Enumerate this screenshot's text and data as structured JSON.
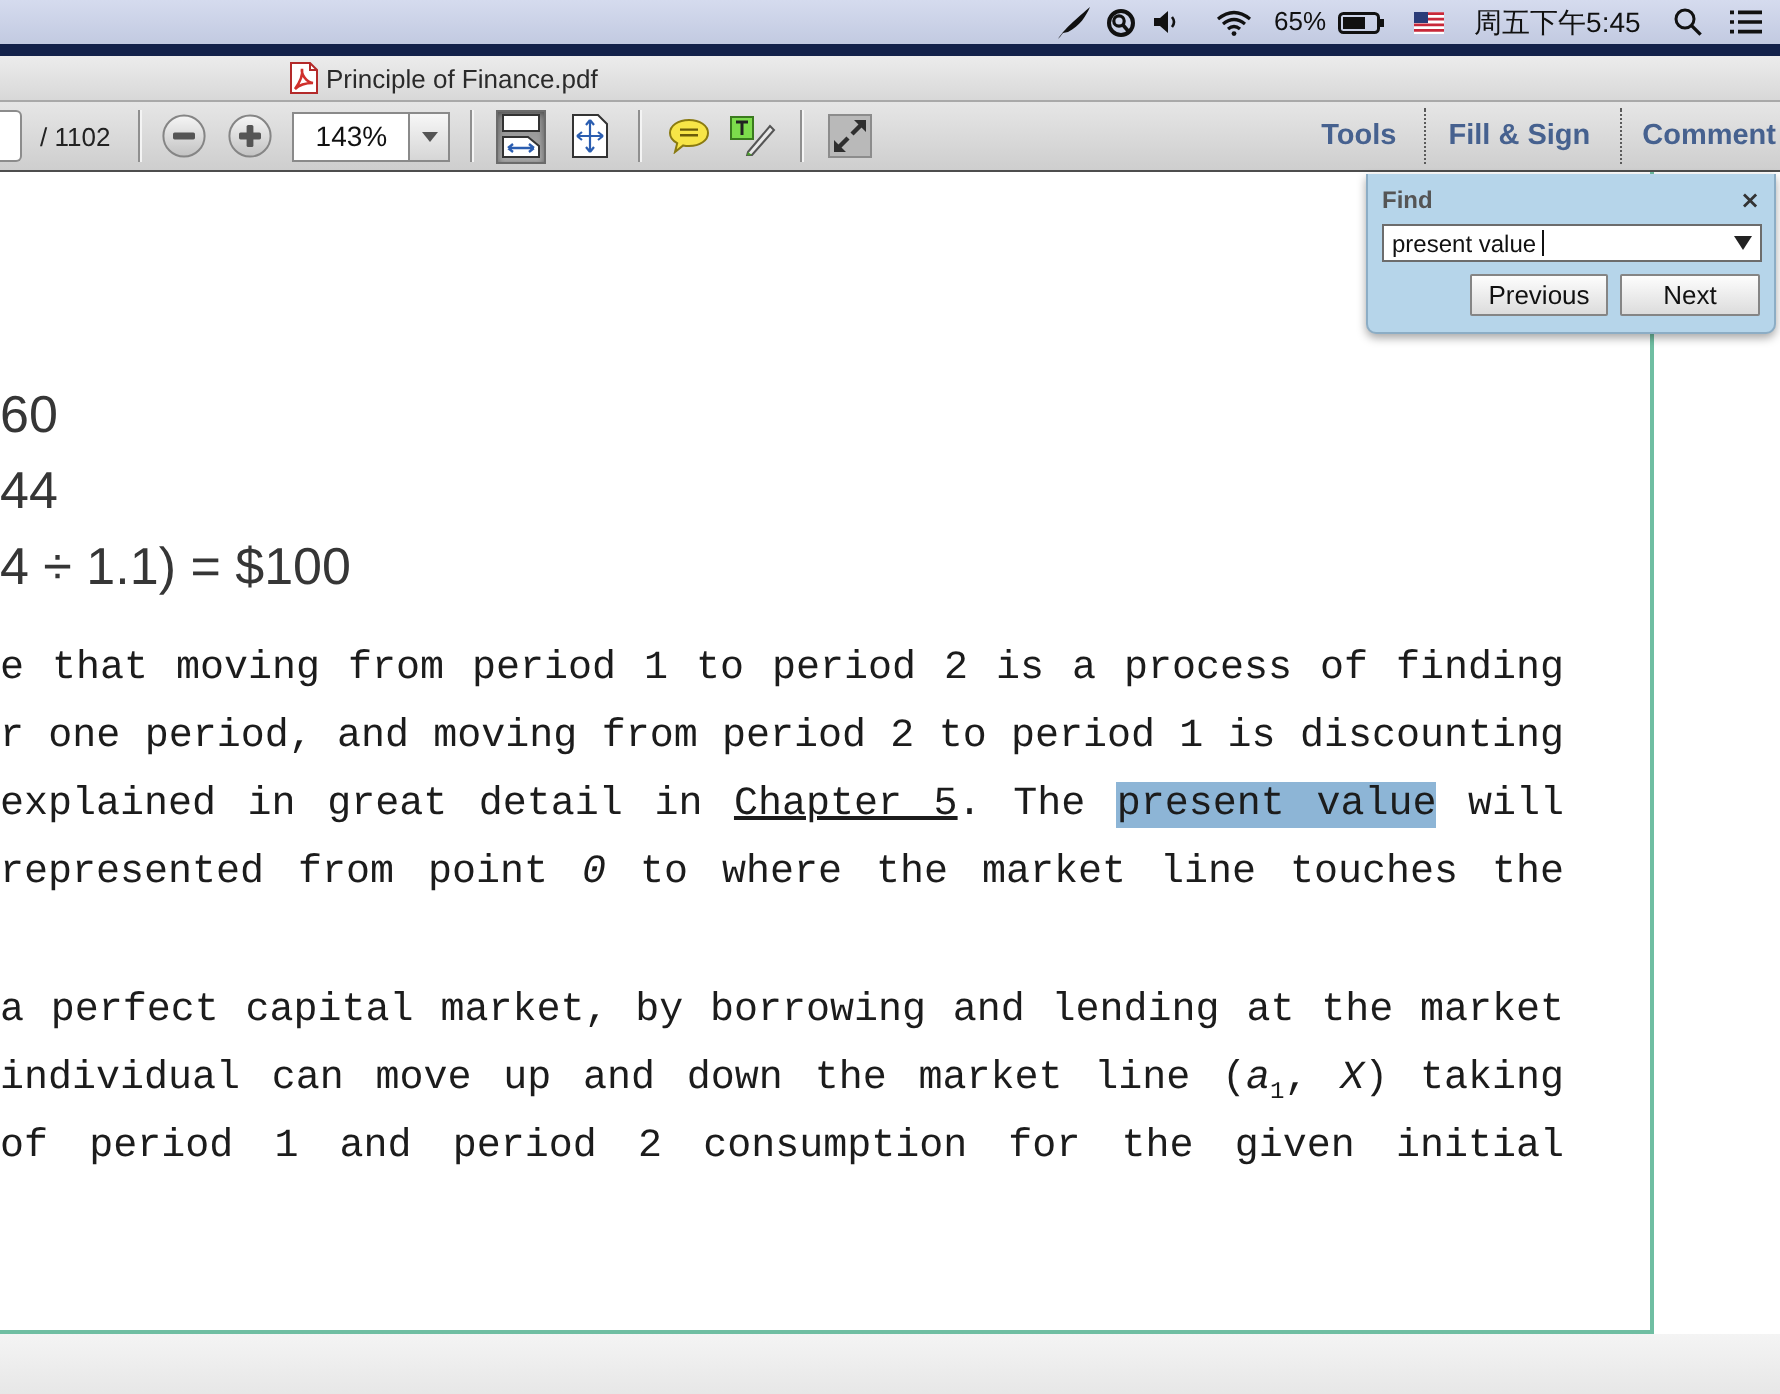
{
  "menu_bar": {
    "battery_reading": "65%",
    "clock": "周五下午5:45"
  },
  "window": {
    "title": "Principle of Finance.pdf"
  },
  "toolbar": {
    "page_count": "/ 1102",
    "zoom": "143%",
    "view_buttons": [
      {
        "kind": "scroll",
        "selected": true
      },
      {
        "kind": "fit",
        "selected": false
      }
    ],
    "panels": [
      {
        "label": "Tools"
      },
      {
        "label": "Fill & Sign"
      },
      {
        "label": "Comment"
      }
    ]
  },
  "find": {
    "title": "Find",
    "close": "×",
    "value": "present value",
    "buttons": [
      {
        "label": "Previous"
      },
      {
        "label": "Next"
      }
    ]
  },
  "document": {
    "equations": [
      "60",
      "44",
      "4 ÷ 1.1) = $100"
    ],
    "paragraphs": [
      {
        "lines": [
          {
            "segments": [
              {
                "kind": "text",
                "text": "e that moving from period 1 to period 2 is a process of finding"
              }
            ]
          },
          {
            "segments": [
              {
                "kind": "text",
                "text": "r one period, and moving from period 2 to period 1 is discounting"
              }
            ]
          },
          {
            "segments": [
              {
                "kind": "text",
                "text": "explained in great detail in "
              },
              {
                "kind": "link",
                "text": "Chapter 5"
              },
              {
                "kind": "text",
                "text": ". The "
              },
              {
                "kind": "match",
                "text": "present value"
              },
              {
                "kind": "text",
                "text": " will"
              }
            ]
          },
          {
            "segments": [
              {
                "kind": "text",
                "text": "represented from point *0* to where the market line touches the"
              }
            ]
          }
        ]
      },
      {
        "lines": [
          {
            "segments": [
              {
                "kind": "text",
                "text": "a perfect capital market, by borrowing and lending at the market"
              }
            ]
          },
          {
            "segments": [
              {
                "kind": "text",
                "text": "individual can move up and down the market line (*a*$_{1}$, *X*) taking"
              }
            ]
          },
          {
            "segments": [
              {
                "kind": "text",
                "text": "of period 1 and period 2 consumption for the given initial"
              }
            ]
          }
        ]
      }
    ]
  }
}
